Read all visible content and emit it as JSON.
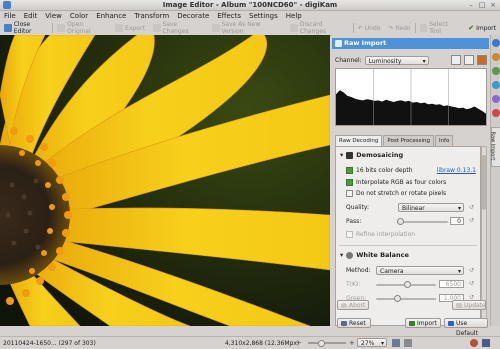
{
  "window": {
    "title": "Image Editor - Album \"100NCD60\" - digiKam"
  },
  "menu": [
    "File",
    "Edit",
    "View",
    "Color",
    "Enhance",
    "Transform",
    "Decorate",
    "Effects",
    "Settings",
    "Help"
  ],
  "toolbar": {
    "close_editor": "Close Editor",
    "open_original": "Open Original",
    "export": "Export",
    "save_changes": "Save Changes",
    "save_new_version": "Save As New Version",
    "discard_changes": "Discard Changes",
    "undo": "Undo",
    "redo": "Redo",
    "select_tool": "Select Tool",
    "import": "Import"
  },
  "panel": {
    "title": "Raw Import",
    "channel_label": "Channel:",
    "channel_value": "Luminosity",
    "tabs": [
      "Raw Decoding",
      "Post Processing",
      "Info"
    ],
    "demosaicing": {
      "title": "Demosaicing",
      "color_depth": "16 bits color depth",
      "libraw_link": "libraw 0.13.1",
      "interpolate_rgb": "Interpolate RGB as four colors",
      "no_stretch": "Do not stretch or rotate pixels",
      "quality_label": "Quality:",
      "quality_value": "Bilinear",
      "pass_label": "Pass:",
      "pass_value": "0",
      "refine": "Refine interpolation"
    },
    "white_balance": {
      "title": "White Balance",
      "method_label": "Method:",
      "method_value": "Camera",
      "tk_label": "T(K):",
      "tk_value": "6500",
      "green_label": "Green:",
      "green_value": "1.000"
    },
    "buttons": {
      "abort": "Abort",
      "update": "Update",
      "reset": "Reset",
      "import": "Import",
      "use_default": "Use Default"
    }
  },
  "status": {
    "filename": "20110424-1650... (297 of 303)",
    "dimensions": "4,310x2,868 (12.36Mpx)",
    "zoom": "27%"
  },
  "sidetab": {
    "label": "Raw Import"
  },
  "chart_data": {
    "type": "area",
    "title": "",
    "series": [
      {
        "values": [
          0.55,
          0.62,
          0.58,
          0.52,
          0.5,
          0.47,
          0.45,
          0.44,
          0.46,
          0.45,
          0.43,
          0.44,
          0.42,
          0.45,
          0.43,
          0.41,
          0.43,
          0.44,
          0.42,
          0.43,
          0.4,
          0.41,
          0.39,
          0.4,
          0.37,
          0.38,
          0.36,
          0.37,
          0.34,
          0.35,
          0.33,
          0.32,
          0.3,
          0.31,
          0.28,
          0.3,
          0.33,
          0.29,
          0.25,
          0.2
        ]
      }
    ],
    "ylim": [
      0,
      1
    ]
  },
  "colors": {
    "accent": "#4e92d8",
    "flower": "#f2c418",
    "background": "#1a2008"
  }
}
